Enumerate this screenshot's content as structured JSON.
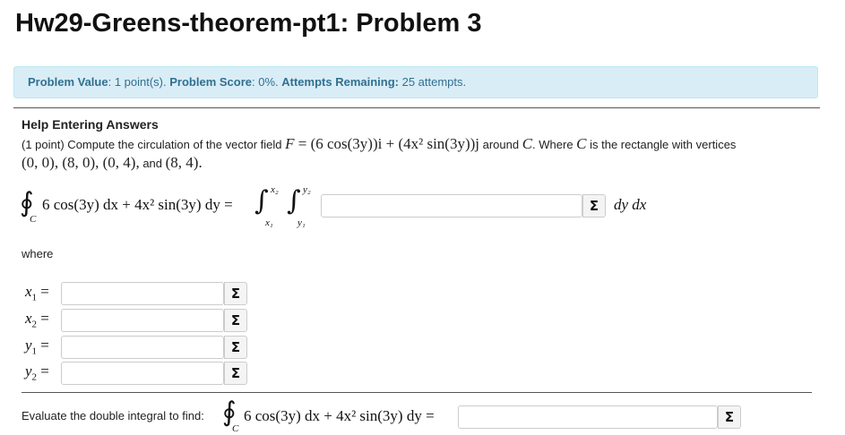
{
  "page": {
    "title": "Hw29-Greens-theorem-pt1: Problem 3"
  },
  "info": {
    "value_label": "Problem Value",
    "value_text": ": 1 point(s). ",
    "score_label": "Problem Score",
    "score_text": ": 0%. ",
    "attempts_label": "Attempts Remaining:",
    "attempts_text": " 25 attempts."
  },
  "problem": {
    "help_heading": "Help Entering Answers",
    "prefix": "(1 point) Compute the circulation of the vector field ",
    "F": "F",
    "eq": " = ",
    "field_expr": "(6 cos(3y))i + (4x² sin(3y))j",
    "around_text": " around ",
    "C": "C",
    "where_text": ". Where ",
    "rect_text": " is the rectangle with vertices",
    "vertices": "(0, 0), (8, 0), (0, 4),",
    "and_text": " and ",
    "last_vertex": "(8, 4)."
  },
  "equation": {
    "integrand": "6 cos(3y)  dx + 4x² sin(3y)  dy =",
    "x2": "x₂",
    "x1": "x₁",
    "y2": "y₂",
    "y1": "y₁",
    "C": "C",
    "dydx": "dy dx"
  },
  "where_label": "where",
  "bounds": [
    {
      "var": "x",
      "sub": "1",
      "value": ""
    },
    {
      "var": "x",
      "sub": "2",
      "value": ""
    },
    {
      "var": "y",
      "sub": "1",
      "value": ""
    },
    {
      "var": "y",
      "sub": "2",
      "value": ""
    }
  ],
  "final": {
    "prompt": "Evaluate the double integral to find:",
    "integrand": "6 cos(3y)  dx + 4x² sin(3y)  dy =",
    "C": "C",
    "value": ""
  },
  "sigma_symbol": "Σ",
  "oint_symbol": "∮",
  "int_symbol": "∫",
  "equals": "="
}
